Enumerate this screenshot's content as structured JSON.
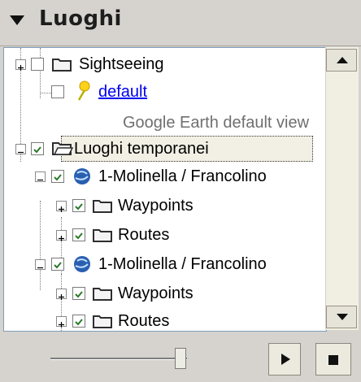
{
  "panel": {
    "title": "Luoghi",
    "collapse_icon": "triangle-down-icon"
  },
  "tree": {
    "items": [
      {
        "label": "Sightseeing",
        "icon": "folder-icon",
        "checked": false,
        "expander": "plus"
      },
      {
        "label": "default",
        "icon": "pushpin-icon",
        "checked": false,
        "link": true
      },
      {
        "label": "Google Earth default view",
        "description": true
      },
      {
        "label": "Luoghi temporanei",
        "icon": "folder-open-icon",
        "checked": true,
        "expander": "minus",
        "selected": true
      },
      {
        "label": "1-Molinella / Francolino",
        "icon": "globe-icon",
        "checked": true,
        "expander": "minus"
      },
      {
        "label": "Waypoints",
        "icon": "folder-icon",
        "checked": true,
        "expander": "plus"
      },
      {
        "label": "Routes",
        "icon": "folder-icon",
        "checked": true,
        "expander": "plus"
      },
      {
        "label": "1-Molinella / Francolino",
        "icon": "globe-icon",
        "checked": true,
        "expander": "minus"
      },
      {
        "label": "Waypoints",
        "icon": "folder-icon",
        "checked": true,
        "expander": "plus"
      },
      {
        "label": "Routes",
        "icon": "folder-icon",
        "checked": true,
        "expander": "plus"
      }
    ]
  },
  "playback": {
    "slider_level": 0.95,
    "play_icon": "play-icon",
    "stop_icon": "stop-icon"
  }
}
